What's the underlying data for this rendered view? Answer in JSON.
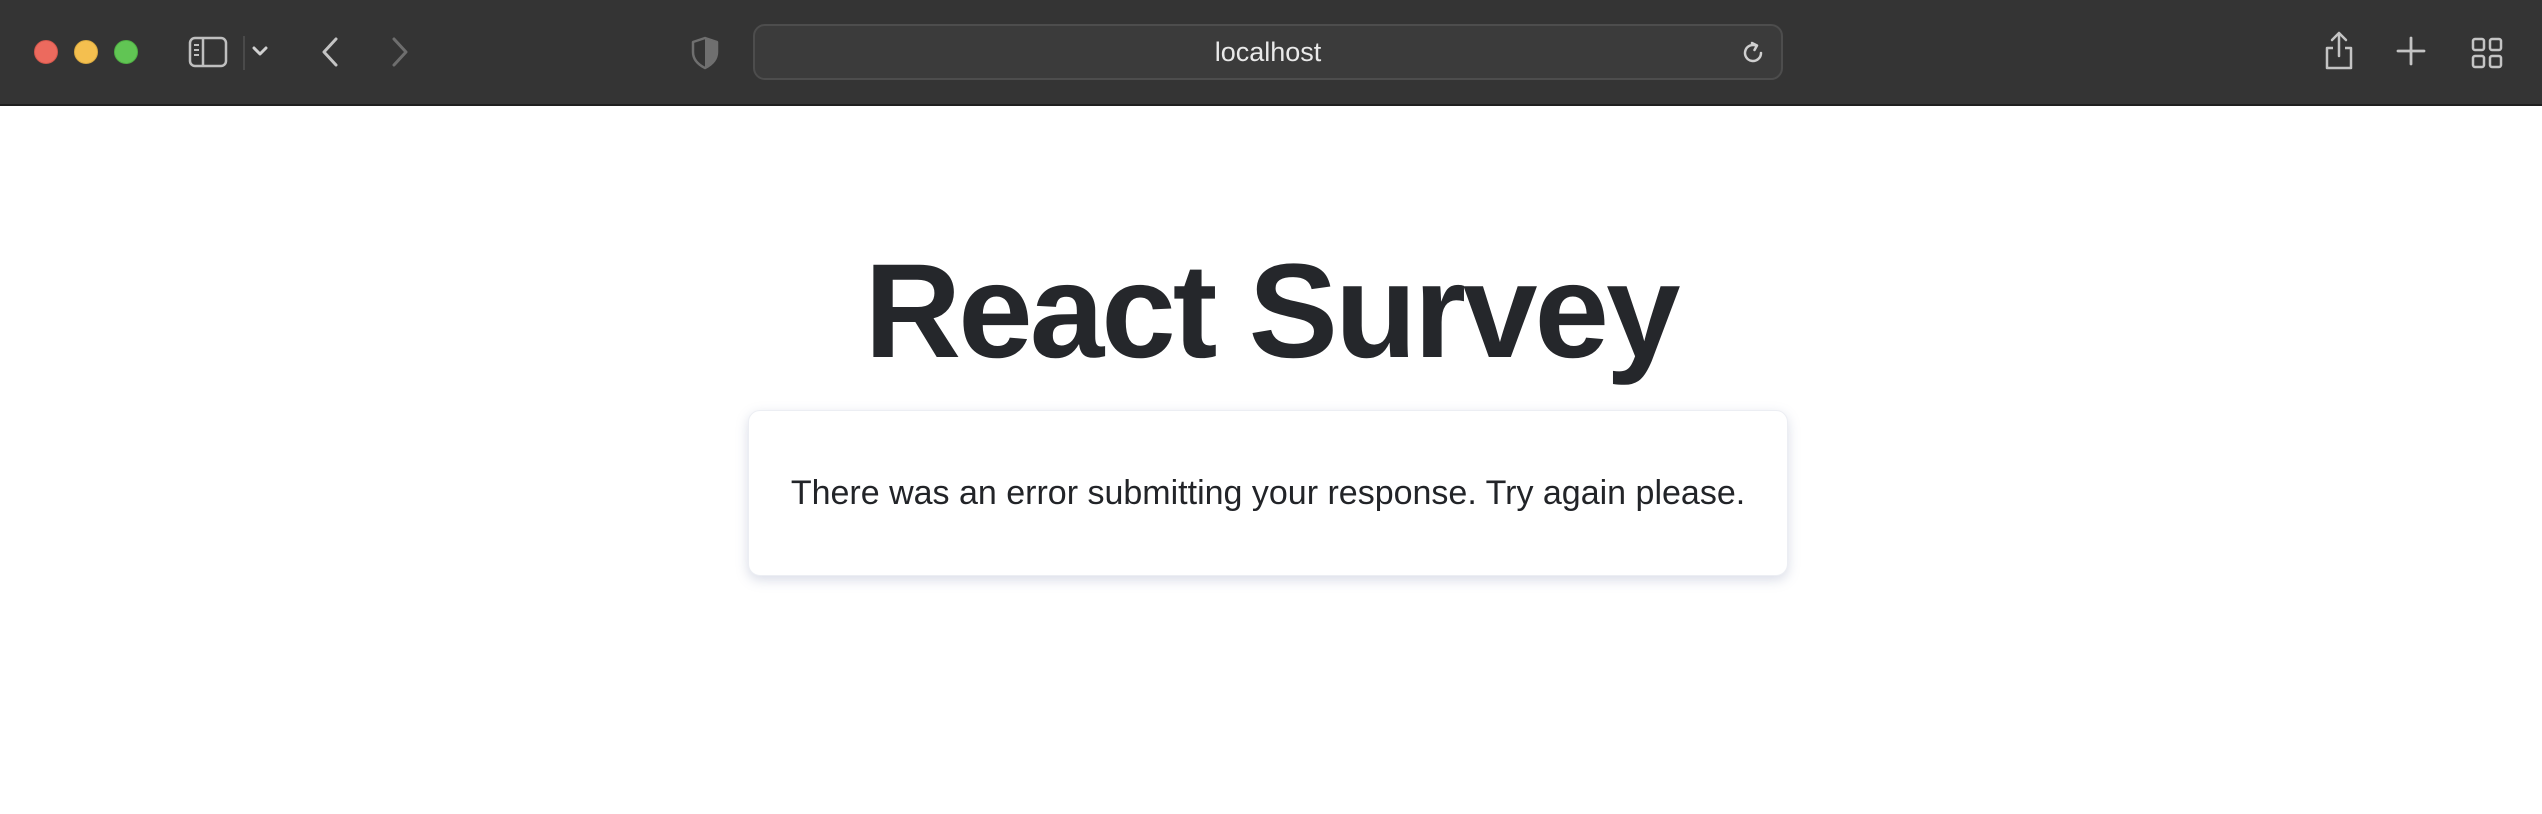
{
  "browser": {
    "address": "localhost",
    "icons": {
      "sidebar": "sidebar-icon",
      "dropdown": "chevron-down-icon",
      "back": "chevron-left-icon",
      "forward": "chevron-right-icon",
      "privacy": "shield-icon",
      "reload": "reload-icon",
      "share": "share-icon",
      "new_tab": "plus-icon",
      "tab_overview": "grid-icon"
    },
    "colors": {
      "toolbar": "#343434",
      "close": "#ec6a5e",
      "minimize": "#f4bf4f",
      "zoom": "#61c554"
    }
  },
  "page": {
    "title": "React Survey",
    "message": "There was an error submitting your response. Try again please."
  }
}
